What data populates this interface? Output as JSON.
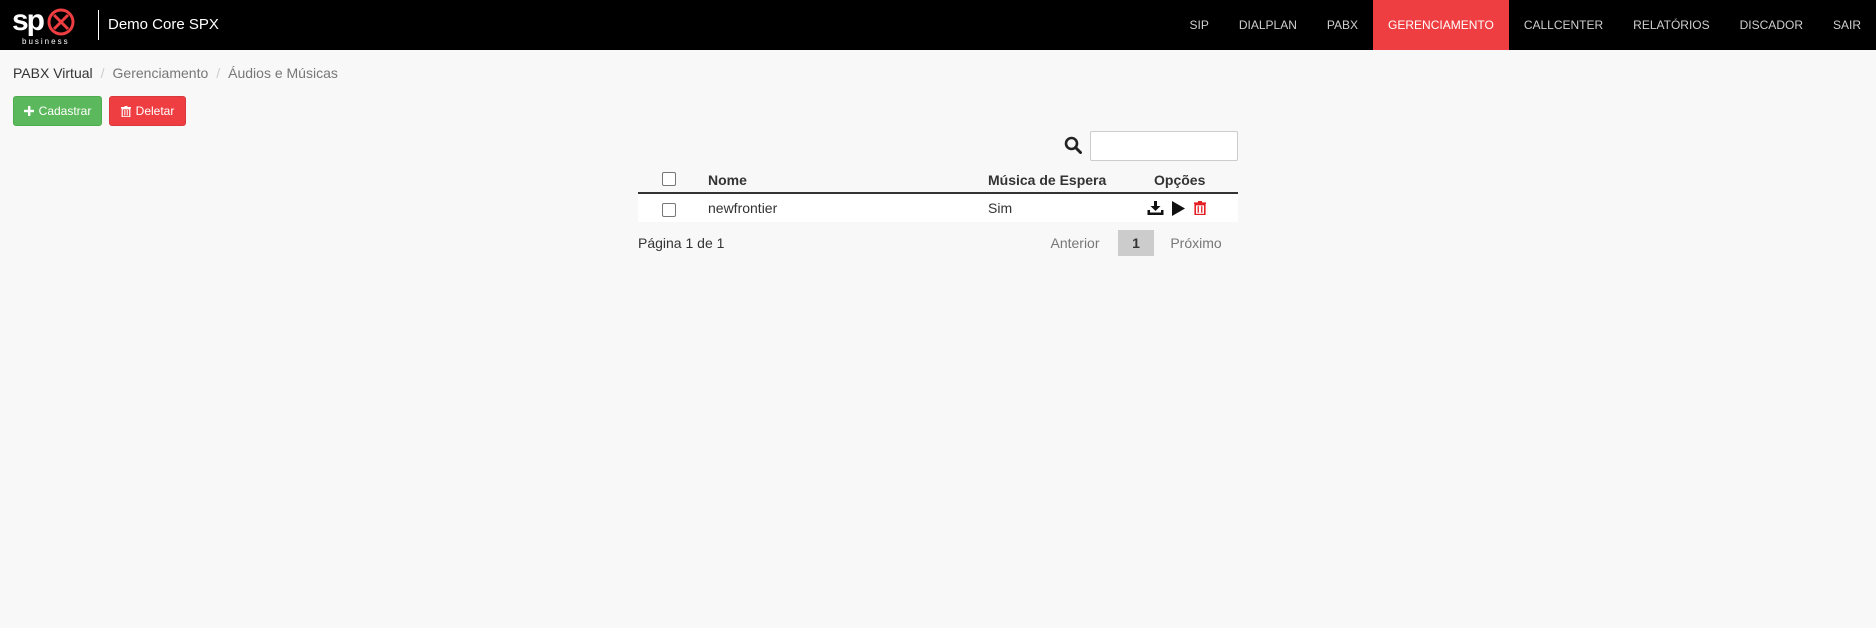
{
  "brand": {
    "logo_text": "sp",
    "logo_sub": "business",
    "name": "Demo Core SPX"
  },
  "nav": [
    {
      "label": "SIP"
    },
    {
      "label": "DIALPLAN"
    },
    {
      "label": "PABX"
    },
    {
      "label": "GERENCIAMENTO"
    },
    {
      "label": "CALLCENTER"
    },
    {
      "label": "RELATÓRIOS"
    },
    {
      "label": "DISCADOR"
    },
    {
      "label": "SAIR"
    }
  ],
  "nav_active": "GERENCIAMENTO",
  "breadcrumb": [
    "PABX Virtual",
    "Gerenciamento",
    "Áudios e Músicas"
  ],
  "breadcrumb_sep": "/",
  "actions": {
    "add_label": "Cadastrar",
    "delete_label": "Deletar"
  },
  "search": {
    "value": "",
    "placeholder": ""
  },
  "table": {
    "headers": {
      "name": "Nome",
      "hold_music": "Música de Espera",
      "options": "Opções"
    },
    "rows": [
      {
        "name": "newfrontier",
        "hold_music": "Sim"
      }
    ]
  },
  "pagination": {
    "info": "Página 1 de 1",
    "prev": "Anterior",
    "current": "1",
    "next": "Próximo"
  },
  "colors": {
    "navbar": "#000000",
    "active": "#ee3e41",
    "success": "#5cb85c",
    "danger": "#ee3e41",
    "background": "#f8f8f8"
  },
  "icons": [
    "plus-icon",
    "trash-icon",
    "search-icon",
    "download-icon",
    "play-icon",
    "delete-icon"
  ]
}
